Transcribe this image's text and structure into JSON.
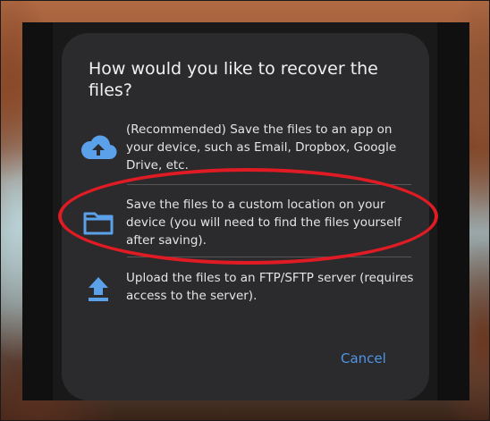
{
  "dialog": {
    "title": "How would you like to recover the files?",
    "options": [
      {
        "label": "(Recommended) Save the files to an app on your device, such as Email, Dropbox, Google Drive, etc.",
        "icon": "cloud-upload-icon"
      },
      {
        "label": "Save the files to a custom location on your device (you will need to find the files yourself after saving).",
        "icon": "folder-icon"
      },
      {
        "label": "Upload the files to an FTP/SFTP server (requires access to the server).",
        "icon": "upload-icon"
      }
    ],
    "cancel_label": "Cancel"
  },
  "colors": {
    "accent": "#4e95e4",
    "dialog_bg": "#2b2b2d",
    "highlight": "#e01b24"
  }
}
